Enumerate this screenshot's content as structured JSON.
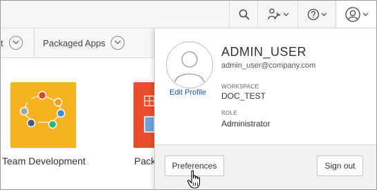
{
  "topbar": {
    "icons": [
      "search-icon",
      "wrench-person-icon",
      "help-icon",
      "user-icon"
    ]
  },
  "navbar": {
    "partial_item_label": "t",
    "packaged_apps_label": "Packaged Apps"
  },
  "tiles": [
    {
      "label": "Team Development",
      "color": "#f6b321"
    },
    {
      "label": "Pack",
      "color": "#e84e2b"
    }
  ],
  "user_menu": {
    "username": "ADMIN_USER",
    "email": "admin_user@company.com",
    "edit_profile_label": "Edit Profile",
    "workspace_label": "WORKSPACE",
    "workspace_value": "DOC_TEST",
    "role_label": "ROLE",
    "role_value": "Administrator",
    "preferences_label": "Preferences",
    "sign_out_label": "Sign out"
  },
  "colors": {
    "link": "#1a5a9b",
    "team_tile": "#f6b321",
    "packaged_tile": "#e84e2b"
  }
}
